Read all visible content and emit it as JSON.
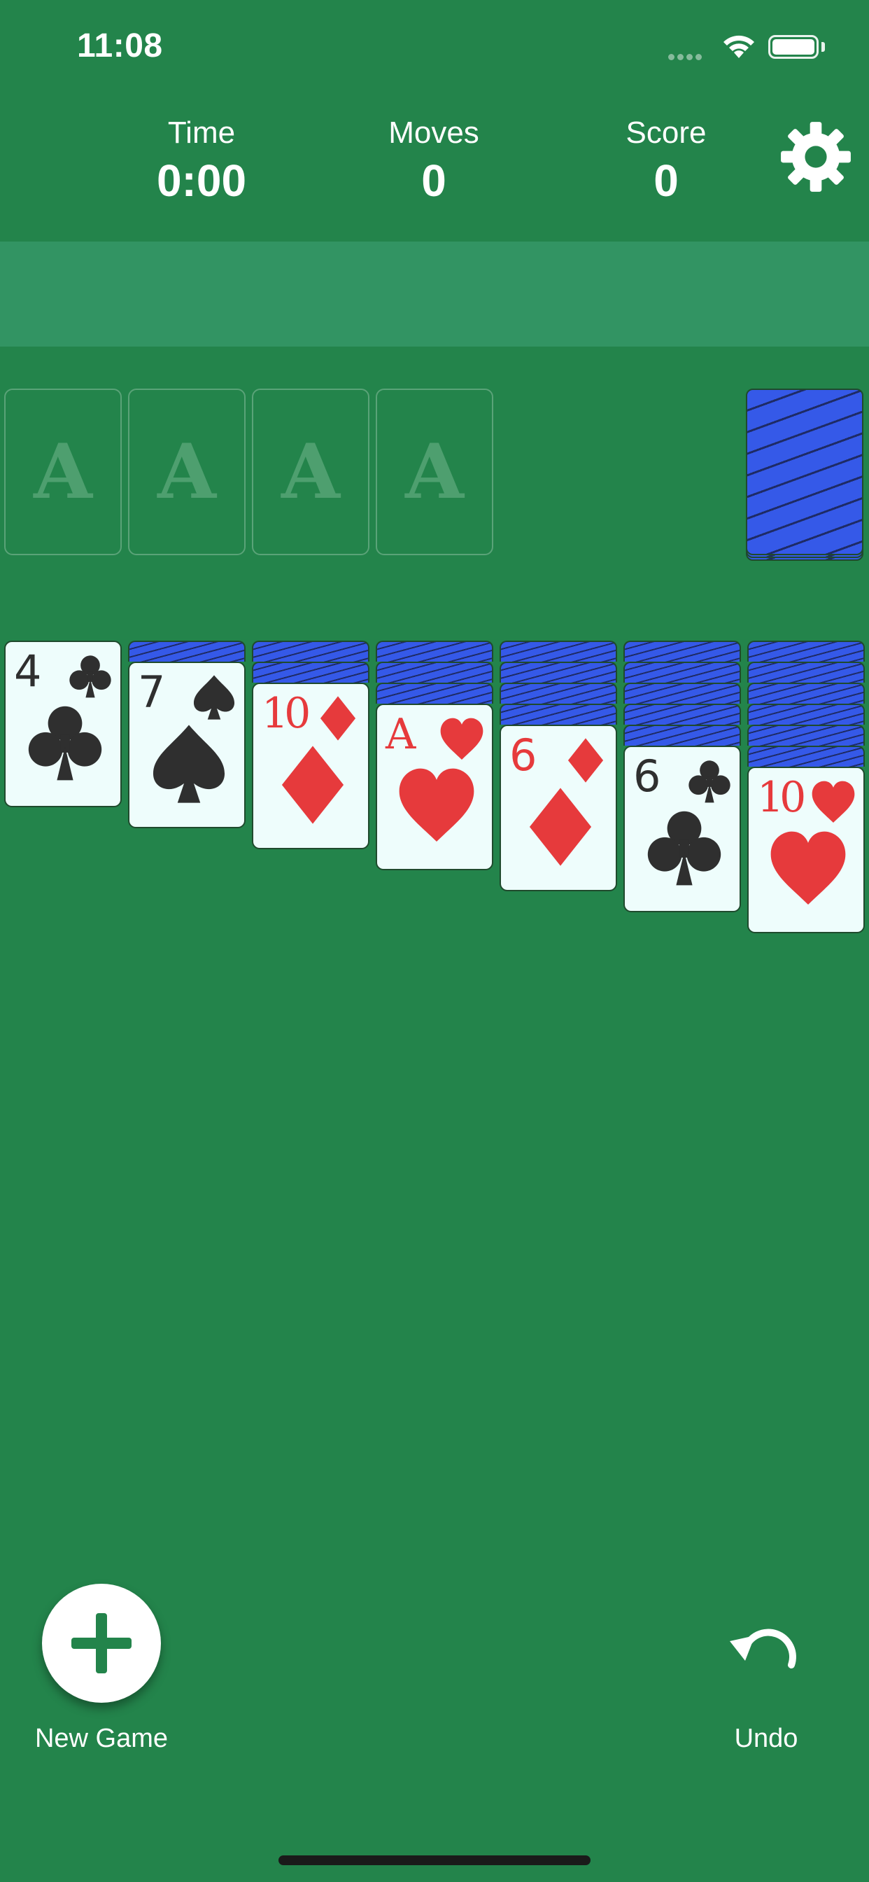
{
  "status_bar": {
    "time": "11:08"
  },
  "stats": [
    {
      "label": "Time",
      "value": "0:00"
    },
    {
      "label": "Moves",
      "value": "0"
    },
    {
      "label": "Score",
      "value": "0"
    }
  ],
  "foundations": [
    "A",
    "A",
    "A",
    "A"
  ],
  "tableau": [
    {
      "rank": "4",
      "suit": "club",
      "color": "black",
      "hidden": 0
    },
    {
      "rank": "7",
      "suit": "spade",
      "color": "black",
      "hidden": 1
    },
    {
      "rank": "10",
      "suit": "diamond",
      "color": "red",
      "hidden": 2
    },
    {
      "rank": "A",
      "suit": "heart",
      "color": "red",
      "hidden": 3
    },
    {
      "rank": "6",
      "suit": "diamond",
      "color": "red",
      "hidden": 4
    },
    {
      "rank": "6",
      "suit": "club",
      "color": "black",
      "hidden": 5
    },
    {
      "rank": "10",
      "suit": "heart",
      "color": "red",
      "hidden": 6
    }
  ],
  "controls": {
    "new_game_label": "New Game",
    "undo_label": "Undo"
  },
  "colors": {
    "felt": "#23844b",
    "banner": "#329463",
    "card_back": "#3559e8",
    "card_face": "#eefdfc",
    "red_suit": "#e63a3c",
    "black_suit": "#2f2f2f"
  },
  "icons": {
    "settings": "gear-icon",
    "new_game": "plus-icon",
    "undo": "undo-icon"
  }
}
